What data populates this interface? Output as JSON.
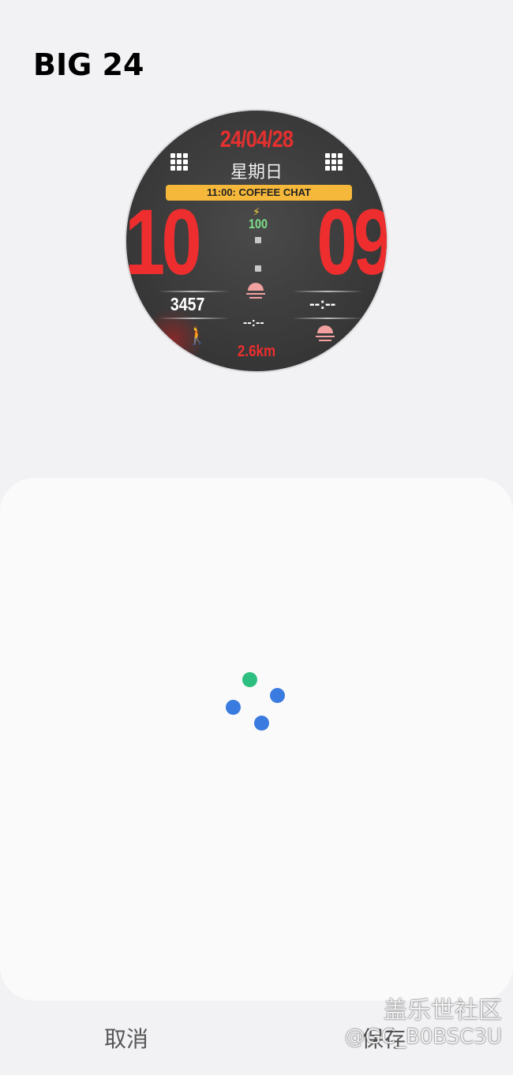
{
  "header": {
    "title": "BIG 24"
  },
  "watch_face": {
    "date": "24/04/28",
    "weekday": "星期日",
    "event": "11:00: COFFEE CHAT",
    "hours": "10",
    "minutes": "09",
    "battery": "100",
    "steps": "3457",
    "time_right": "--:--",
    "time_center": "--:--",
    "distance": "2.6km",
    "colors": {
      "digits": "#ee2e2e",
      "event_bg": "#f5b83a",
      "battery": "#7ee08a",
      "sun": "#f2a0a0"
    }
  },
  "loading": {
    "colors": [
      "#2dbf7f",
      "#3a7be0",
      "#3a7be0",
      "#3a7be0"
    ]
  },
  "footer": {
    "cancel_label": "取消",
    "save_label": "保存"
  },
  "watermark": {
    "line1": "盖乐世社区",
    "line2": "@GC_B0BSC3U"
  }
}
